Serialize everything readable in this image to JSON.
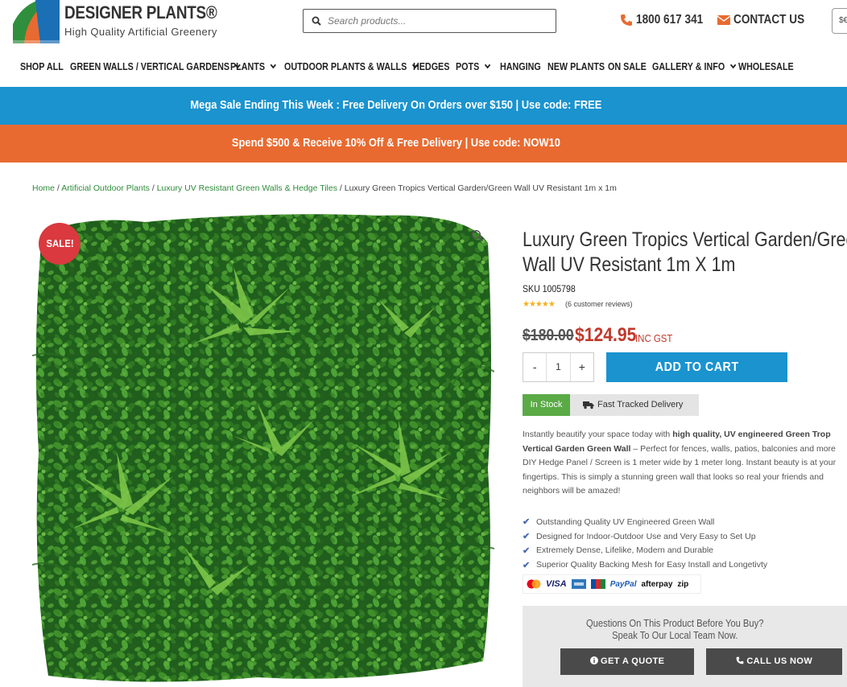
{
  "header": {
    "brand": "DESIGNER PLANTS®",
    "tagline": "High Quality Artificial Greenery",
    "search_placeholder": "Search products...",
    "phone": "1800 617 341",
    "contact": "CONTACT US",
    "currency": "$€"
  },
  "nav": {
    "items": [
      {
        "label": "SHOP ALL"
      },
      {
        "label": "GREEN WALLS / VERTICAL GARDENS"
      },
      {
        "label": "PLANTS"
      },
      {
        "label": "OUTDOOR PLANTS & WALLS"
      },
      {
        "label": "HEDGES"
      },
      {
        "label": "POTS"
      },
      {
        "label": "HANGING"
      },
      {
        "label": "NEW PLANTS"
      },
      {
        "label": "ON SALE"
      },
      {
        "label": "GALLERY & INFO"
      },
      {
        "label": "WHOLESALE"
      }
    ]
  },
  "banners": {
    "top": "Mega Sale Ending This Week : Free Delivery On Orders over $150 | Use code: FREE",
    "bottom": "Spend $500 & Receive 10% Off & Free Delivery | Use code: NOW10"
  },
  "breadcrumb": {
    "home": "Home",
    "sep": " / ",
    "cat1": "Artificial Outdoor Plants",
    "cat2": "Luxury UV Resistant Green Walls & Hedge Tiles",
    "current": "Luxury Green Tropics Vertical Garden/Green Wall UV Resistant 1m x 1m"
  },
  "product": {
    "sale_badge": "SALE!",
    "title_line1": "Luxury Green Tropics Vertical Garden/Green",
    "title_line2": "Wall UV Resistant 1m X 1m",
    "sku": "SKU 1005798",
    "stars": "★★★★★",
    "rating": 5,
    "reviews": "(6 customer reviews)",
    "old_price": "$180.00",
    "new_price": "$124.95",
    "gst": "INC GST",
    "qty_minus": "-",
    "qty_value": "1",
    "qty_plus": "+",
    "add_to_cart": "ADD TO CART",
    "stock": "In Stock",
    "delivery": "Fast Tracked Delivery",
    "desc": {
      "p1": "Instantly beautify your space today with ",
      "b1": "high quality, UV engineered Green Trop",
      "b2": "Vertical Garden Green Wall",
      "p2": " – Perfect for fences, walls, patios, balconies and more",
      "l3": "DIY Hedge Panel / Screen is 1 meter wide by 1 meter long. Instant beauty is at your",
      "l4": "fingertips. This is simply a stunning green wall that looks so real your friends and",
      "l5": "neighbors will be amazed!"
    },
    "features": [
      "Outstanding Quality UV Engineered Green Wall",
      "Designed for Indoor-Outdoor Use and Very Easy to Set Up",
      "Extremely Dense, Lifelike, Modern and Durable",
      "Superior Quality Backing Mesh for Easy Install and Longetivty"
    ],
    "payments": {
      "visa": "VISA",
      "paypal": "PayPal",
      "afterpay": "afterpay",
      "zip": "zip"
    }
  },
  "quote": {
    "line1": "Questions On This Product Before You Buy?",
    "line2": "Speak To Our Local Team Now.",
    "get_quote": "GET A QUOTE",
    "call_us": "CALL US NOW"
  },
  "colors": {
    "blue": "#1a93cf",
    "orange": "#e86a30",
    "sale_red": "#d9393f",
    "price_red": "#c0392b",
    "stock_green": "#5aaa46"
  }
}
